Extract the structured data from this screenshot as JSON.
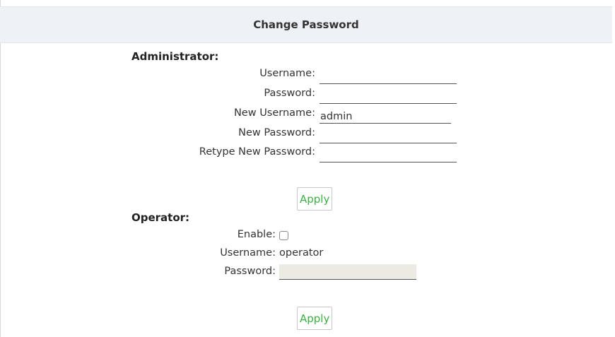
{
  "header": {
    "title": "Change Password"
  },
  "administrator": {
    "section_title": "Administrator:",
    "username_label": "Username:",
    "username_value": "",
    "password_label": "Password:",
    "password_value": "",
    "new_username_label": "New Username:",
    "new_username_value": "admin",
    "new_password_label": "New Password:",
    "new_password_value": "",
    "retype_password_label": "Retype New Password:",
    "retype_password_value": "",
    "apply_label": "Apply"
  },
  "operator": {
    "section_title": "Operator:",
    "enable_label": "Enable:",
    "enable_checked": false,
    "username_label": "Username:",
    "username_value": "operator",
    "password_label": "Password:",
    "password_value": "",
    "apply_label": "Apply"
  },
  "colors": {
    "header_bg": "#eef2f6",
    "apply_text": "#3cb043",
    "disabled_field_bg": "#ebebe4"
  }
}
